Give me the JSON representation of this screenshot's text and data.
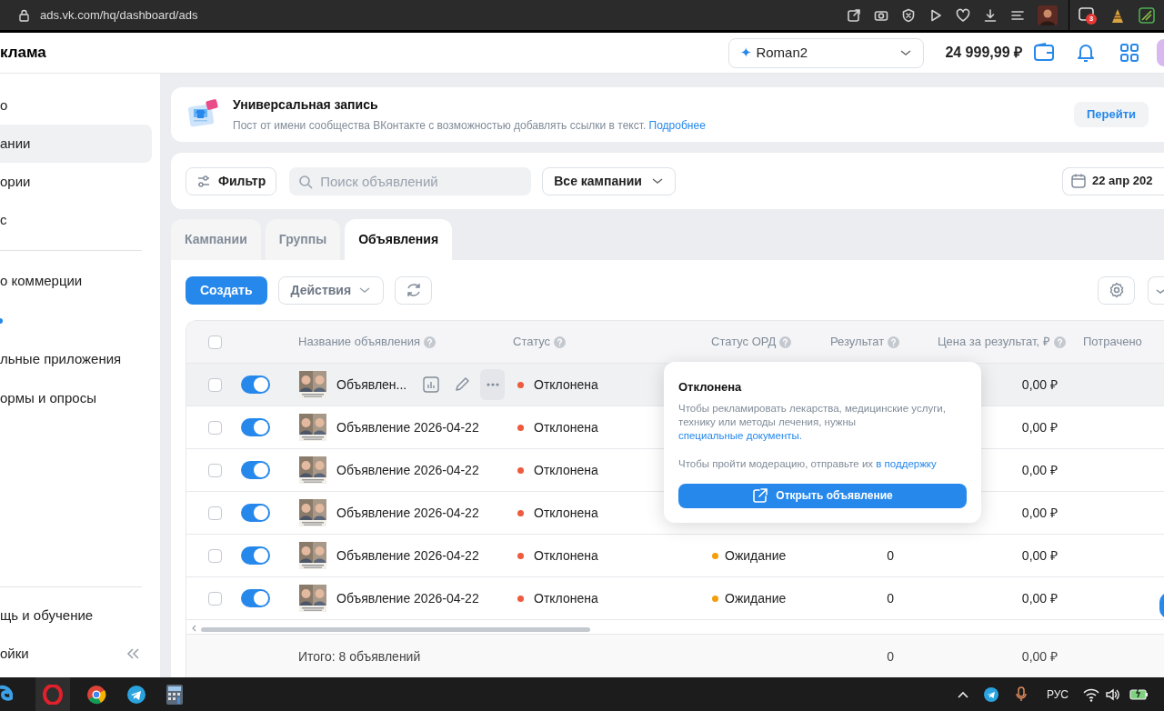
{
  "browser": {
    "url": "ads.vk.com/hq/dashboard/ads",
    "extension_badge": "3"
  },
  "header": {
    "title": "клама",
    "account_mark": "✦",
    "account": "Roman2",
    "balance": "24 999,99 ₽"
  },
  "sidebar": {
    "top": [
      {
        "label": "о",
        "selected": false
      },
      {
        "label": "ании",
        "selected": true
      },
      {
        "label": "ории",
        "selected": false
      },
      {
        "label": "с",
        "selected": false
      }
    ],
    "middle": [
      {
        "kind": "item",
        "label": "о коммерции"
      },
      {
        "kind": "dot"
      },
      {
        "kind": "item",
        "label": "льные приложения"
      },
      {
        "kind": "item",
        "label": "ормы и опросы"
      }
    ],
    "bottom": [
      "щь и обучение",
      "ойки"
    ]
  },
  "banner": {
    "title": "Универсальная запись",
    "text": "Пост от имени сообщества ВКонтакте с возможностью добавлять ссылки в текст.",
    "link": "Подробнее",
    "button": "Перейти"
  },
  "filters": {
    "filter_button": "Фильтр",
    "search": {
      "placeholder": "Поиск объявлений"
    },
    "campaign_select": "Все кампании",
    "date": "22 апр 202"
  },
  "tabs": [
    {
      "label": "Кампании",
      "selected": false
    },
    {
      "label": "Группы",
      "selected": false
    },
    {
      "label": "Объявления",
      "selected": true
    }
  ],
  "toolbar": {
    "create": "Создать",
    "actions": "Действия"
  },
  "table": {
    "columns": [
      {
        "label": "Название объявления",
        "help": true
      },
      {
        "label": "Статус",
        "help": true
      },
      {
        "label": "Статус ОРД",
        "help": true
      },
      {
        "label": "Результат",
        "help": true
      },
      {
        "label": "Цена за результат, ₽",
        "help": true
      },
      {
        "label": "Потрачено",
        "help": false
      }
    ],
    "header_checked": false,
    "rows": [
      {
        "checked": false,
        "on": true,
        "hovered": true,
        "name": "Объявлен...",
        "status": {
          "label": "Отклонена",
          "color": "#ee5a3c"
        },
        "price": "0,00 ₽"
      },
      {
        "checked": false,
        "on": true,
        "hovered": false,
        "name": "Объявление 2026-04-22",
        "status": {
          "label": "Отклонена",
          "color": "#ee5a3c"
        },
        "price": "0,00 ₽"
      },
      {
        "checked": false,
        "on": true,
        "hovered": false,
        "name": "Объявление 2026-04-22",
        "status": {
          "label": "Отклонена",
          "color": "#ee5a3c"
        },
        "price": "0,00 ₽"
      },
      {
        "checked": false,
        "on": true,
        "hovered": false,
        "name": "Объявление 2026-04-22",
        "status": {
          "label": "Отклонена",
          "color": "#ee5a3c"
        },
        "price": "0,00 ₽"
      },
      {
        "checked": false,
        "on": true,
        "hovered": false,
        "name": "Объявление 2026-04-22",
        "status": {
          "label": "Отклонена",
          "color": "#ee5a3c"
        },
        "ord_status": {
          "label": "Ожидание",
          "color": "#f59e0b"
        },
        "result": "0",
        "price": "0,00 ₽"
      },
      {
        "checked": false,
        "on": true,
        "hovered": false,
        "name": "Объявление 2026-04-22",
        "status": {
          "label": "Отклонена",
          "color": "#ee5a3c"
        },
        "ord_status": {
          "label": "Ожидание",
          "color": "#f59e0b"
        },
        "result": "0",
        "price": "0,00 ₽"
      }
    ],
    "footer": {
      "total": "Итого: 8 объявлений",
      "result": "0",
      "price": "0,00 ₽"
    }
  },
  "popup": {
    "title": "Отклонена",
    "text_1": "Чтобы рекламировать лекарства, медицинские услуги, технику или методы лечения, нужны",
    "link_1": "специальные документы.",
    "text_2": "Чтобы пройти модерацию, отправьте их",
    "link_2": "в поддержку",
    "button": "Открыть объявление"
  },
  "taskbar": {
    "language": "РУС"
  }
}
